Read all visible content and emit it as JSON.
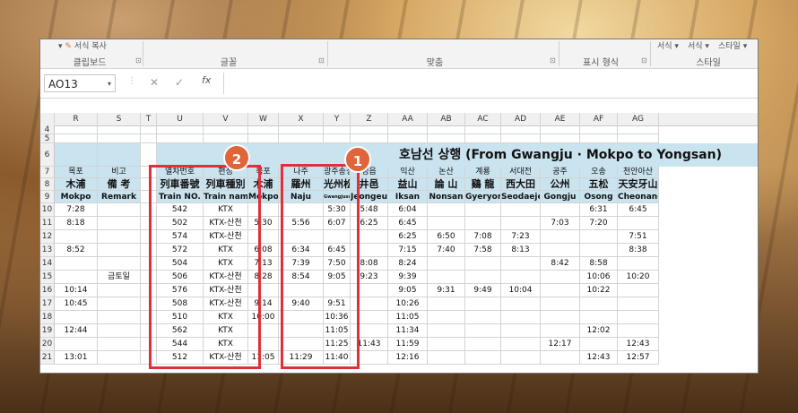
{
  "ribbon": {
    "top_items": [
      "서식 복사",
      "서식",
      "서식",
      "스타일"
    ],
    "groups": [
      "클립보드",
      "글꼴",
      "맞춤",
      "표시 형식",
      "스타일"
    ]
  },
  "formula_bar": {
    "name_box": "AO13",
    "cancel": "✕",
    "enter": "✓",
    "fx": "fx"
  },
  "columns": [
    "R",
    "S",
    "T",
    "U",
    "V",
    "W",
    "X",
    "Y",
    "Z",
    "AA",
    "AB",
    "AC",
    "AD",
    "AE",
    "AF",
    "AG"
  ],
  "row_numbers": [
    "4",
    "5",
    "6",
    "7",
    "8",
    "9",
    "10",
    "11",
    "12",
    "13",
    "14",
    "15",
    "16",
    "17",
    "18",
    "19",
    "20",
    "21"
  ],
  "title": "호남선 상행 (From Gwangju · Mokpo to Yongsan)",
  "header_ko": [
    "목포",
    "비고",
    "",
    "열차번호",
    "편성",
    "목포",
    "나주",
    "광주송정",
    "정읍",
    "익산",
    "논산",
    "계룡",
    "서대전",
    "공주",
    "오송",
    "천안아산"
  ],
  "header_hanja": [
    "木浦",
    "備 考",
    "",
    "列車番號",
    "列車種別",
    "木浦",
    "羅州",
    "光州松汀",
    "井邑",
    "益山",
    "論 山",
    "鷄 龍",
    "西大田",
    "公州",
    "五松",
    "天安牙山"
  ],
  "header_en": [
    "Mokpo",
    "Remark",
    "",
    "Train NO.",
    "Train name",
    "Mokpo",
    "Naju",
    "Gwangjusongjeong",
    "Jeongeup",
    "Iksan",
    "Nonsan",
    "Gyeryong",
    "Seodaejeon",
    "Gongju",
    "Osong",
    "Cheonan-Asan"
  ],
  "rows": [
    [
      "7:28",
      "",
      "",
      "542",
      "KTX",
      "",
      "",
      "5:30",
      "5:48",
      "6:04",
      "",
      "",
      "",
      "",
      "6:31",
      "6:45"
    ],
    [
      "8:18",
      "",
      "",
      "502",
      "KTX-산천",
      "5:30",
      "5:56",
      "6:07",
      "6:25",
      "6:45",
      "",
      "",
      "",
      "7:03",
      "7:20",
      ""
    ],
    [
      "",
      "",
      "",
      "574",
      "KTX-산천",
      "",
      "",
      "",
      "",
      "6:25",
      "6:50",
      "7:08",
      "7:23",
      "",
      "",
      "7:51"
    ],
    [
      "8:52",
      "",
      "",
      "572",
      "KTX",
      "6:08",
      "6:34",
      "6:45",
      "",
      "7:15",
      "7:40",
      "7:58",
      "8:13",
      "",
      "",
      "8:38"
    ],
    [
      "",
      "",
      "",
      "504",
      "KTX",
      "7:13",
      "7:39",
      "7:50",
      "8:08",
      "8:24",
      "",
      "",
      "",
      "8:42",
      "8:58",
      ""
    ],
    [
      "",
      "금토일",
      "",
      "506",
      "KTX-산천",
      "8:28",
      "8:54",
      "9:05",
      "9:23",
      "9:39",
      "",
      "",
      "",
      "",
      "10:06",
      "10:20"
    ],
    [
      "10:14",
      "",
      "",
      "576",
      "KTX-산천",
      "",
      "",
      "",
      "",
      "9:05",
      "9:31",
      "9:49",
      "10:04",
      "",
      "10:22",
      ""
    ],
    [
      "10:45",
      "",
      "",
      "508",
      "KTX-산천",
      "9:14",
      "9:40",
      "9:51",
      "",
      "10:26",
      "",
      "",
      "",
      "",
      "",
      ""
    ],
    [
      "",
      "",
      "",
      "510",
      "KTX",
      "10:00",
      "",
      "10:36",
      "",
      "11:05",
      "",
      "",
      "",
      "",
      "",
      ""
    ],
    [
      "12:44",
      "",
      "",
      "562",
      "KTX",
      "",
      "",
      "11:05",
      "",
      "11:34",
      "",
      "",
      "",
      "",
      "12:02",
      ""
    ],
    [
      "",
      "",
      "",
      "544",
      "KTX",
      "",
      "",
      "11:25",
      "11:43",
      "11:59",
      "",
      "",
      "",
      "12:17",
      "",
      "12:43"
    ],
    [
      "13:01",
      "",
      "",
      "512",
      "KTX-산천",
      "11:05",
      "11:29",
      "11:40",
      "",
      "12:16",
      "",
      "",
      "",
      "",
      "12:43",
      "12:57"
    ]
  ],
  "badges": [
    "2",
    "1"
  ]
}
